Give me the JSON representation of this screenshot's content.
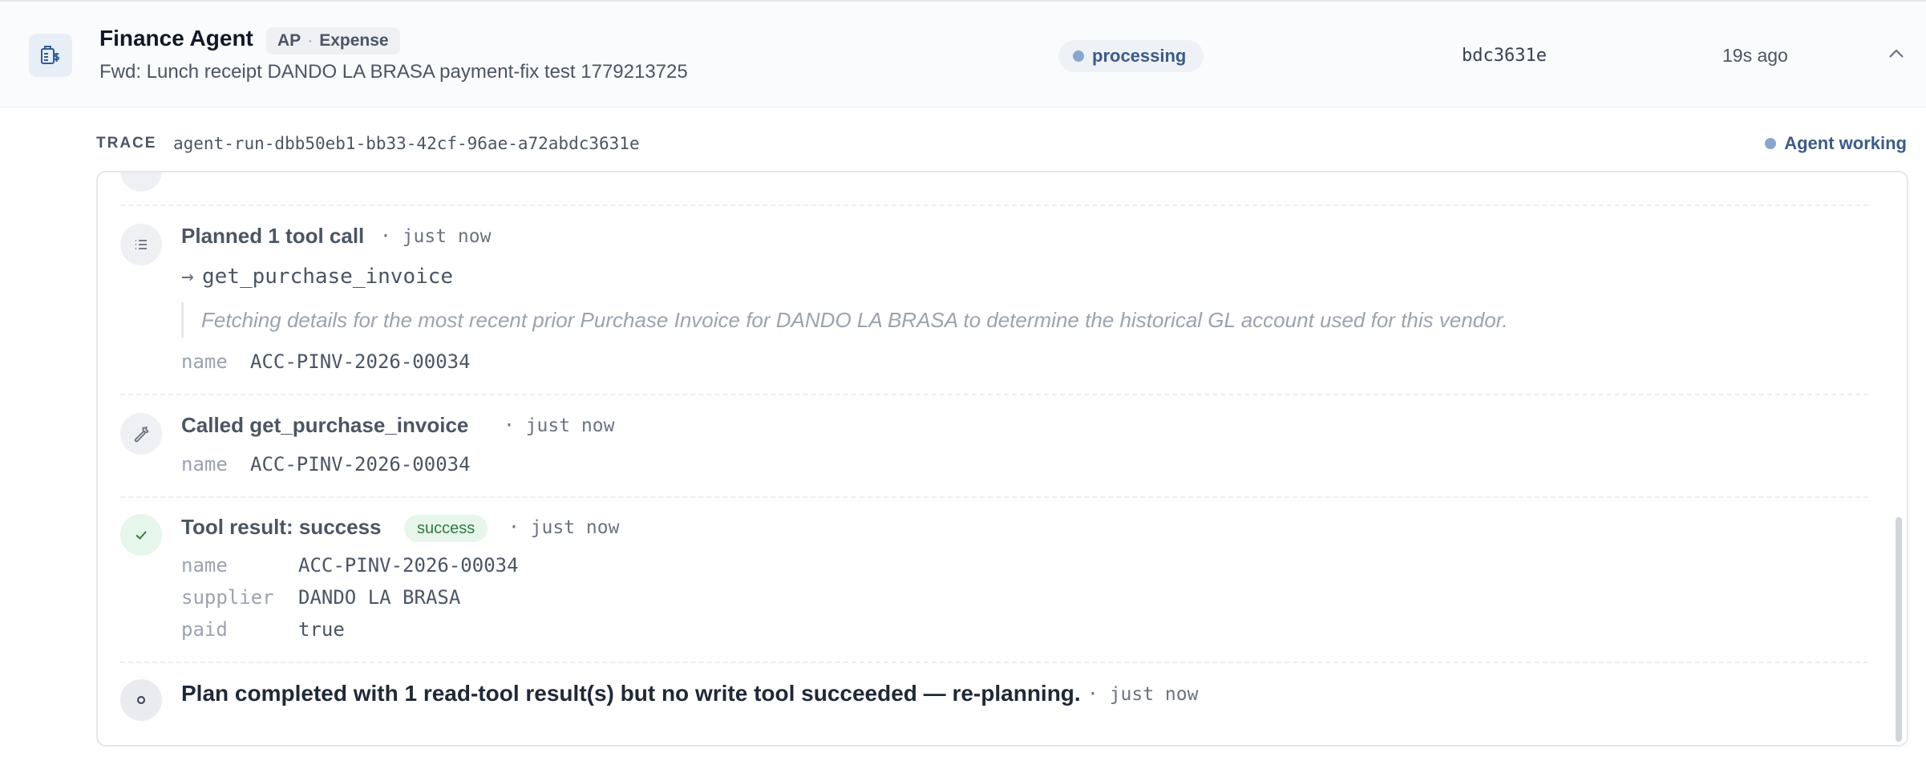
{
  "header": {
    "agent_name": "Finance Agent",
    "tag_primary": "AP",
    "tag_separator": "·",
    "tag_secondary": "Expense",
    "subject": "Fwd: Lunch receipt DANDO LA BRASA payment-fix test 1779213725",
    "status": "processing",
    "run_short_id": "bdc3631e",
    "time_ago": "19s ago",
    "icon": "invoice-dollar-icon",
    "collapse_icon": "chevron-up-icon"
  },
  "trace": {
    "label": "TRACE",
    "run_id": "agent-run-dbb50eb1-bb33-42cf-96ae-a72abdc3631e",
    "state": "Agent working"
  },
  "steps": [
    {
      "icon": "list-icon",
      "title": "Planned 1 tool call",
      "time": "· just now",
      "arrow": "→",
      "function": "get_purchase_invoice",
      "rationale": "Fetching details for the most recent prior Purchase Invoice for DANDO LA BRASA to determine the historical GL account used for this vendor.",
      "params": [
        {
          "key": "name",
          "value": "ACC-PINV-2026-00034"
        }
      ]
    },
    {
      "icon": "wrench-icon",
      "title": "Called get_purchase_invoice",
      "time": "· just now",
      "params": [
        {
          "key": "name",
          "value": "ACC-PINV-2026-00034"
        }
      ]
    },
    {
      "icon": "check-icon",
      "title": "Tool result: success",
      "badge": "success",
      "time": "· just now",
      "params": [
        {
          "key": "name",
          "value": "ACC-PINV-2026-00034"
        },
        {
          "key": "supplier",
          "value": "DANDO LA BRASA"
        },
        {
          "key": "paid",
          "value": "true"
        }
      ]
    },
    {
      "icon": "circle-dot-icon",
      "title": "Plan completed with 1 read-tool result(s) but no write tool succeeded — re-planning.",
      "time": "· just now"
    }
  ],
  "colors": {
    "accent": "#3b5b8a",
    "status_dot": "#8aa6cc",
    "success_bg": "#e7f6ea",
    "success_fg": "#2f7a44"
  }
}
